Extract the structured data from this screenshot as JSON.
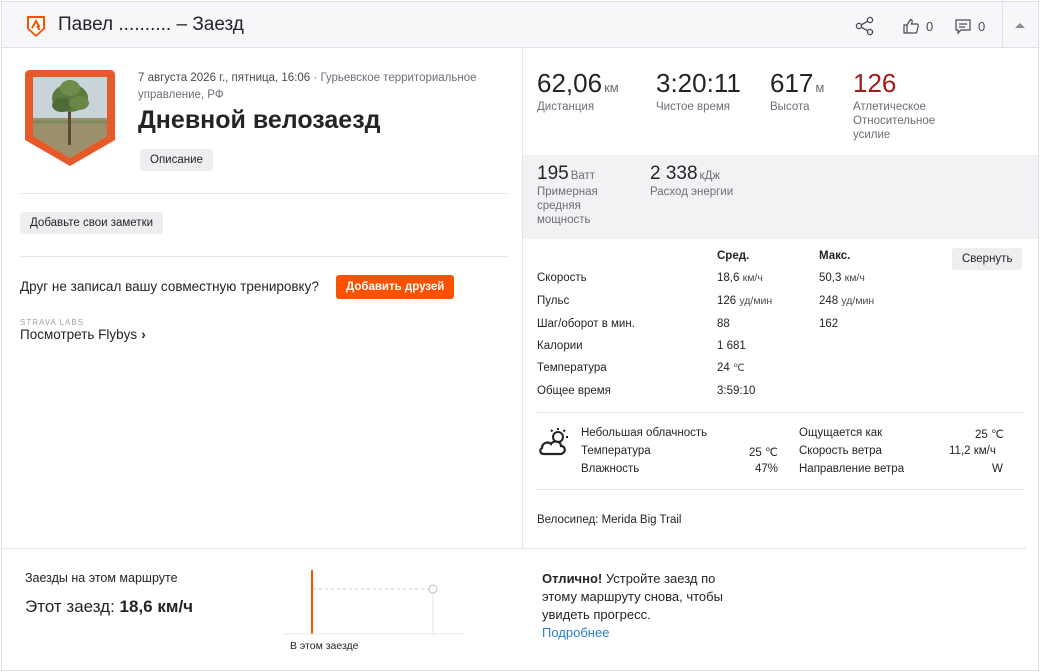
{
  "header": {
    "title": "Павел .......... – Заезд",
    "kudos_count": "0",
    "comments_count": "0"
  },
  "activity": {
    "datetime": "7 августа 2026 г., пятница, 16:06",
    "location": "Гурьевское территориальное управление, РФ",
    "title": "Дневной велозаезд",
    "description_button": "Описание"
  },
  "notes_button": "Добавьте свои заметки",
  "invite": {
    "text": "Друг не записал вашу совместную тренировку?",
    "button": "Добавить друзей"
  },
  "labs": {
    "tag": "STRAVA LABS",
    "link": "Посмотреть Flybys",
    "chevron": "›"
  },
  "primary_stats": [
    {
      "value": "62,06",
      "unit": "км",
      "label": "Дистанция"
    },
    {
      "value": "3:20:11",
      "unit": "",
      "label": "Чистое время"
    },
    {
      "value": "617",
      "unit": "м",
      "label": "Высота"
    },
    {
      "value": "126",
      "unit": "",
      "label": "Атлетическое Относительное усилие"
    }
  ],
  "secondary_stats": [
    {
      "value": "195",
      "unit": "Ватт",
      "label": "Примерная средняя мощность"
    },
    {
      "value": "2 338",
      "unit": "кДж",
      "label": "Расход энергии"
    }
  ],
  "more_stats": {
    "col_avg": "Сред.",
    "col_max": "Макс.",
    "collapse_button": "Свернуть",
    "rows": [
      {
        "label": "Скорость",
        "avg": "18,6",
        "avg_unit": "км/ч",
        "max": "50,3",
        "max_unit": "км/ч"
      },
      {
        "label": "Пульс",
        "avg": "126",
        "avg_unit": "уд/мин",
        "max": "248",
        "max_unit": "уд/мин"
      },
      {
        "label": "Шаг/оборот в мин.",
        "avg": "88",
        "avg_unit": "",
        "max": "162",
        "max_unit": ""
      },
      {
        "label": "Калории",
        "avg": "1 681",
        "avg_unit": "",
        "max": "",
        "max_unit": ""
      },
      {
        "label": "Температура",
        "avg": "24",
        "avg_unit": "℃",
        "max": "",
        "max_unit": ""
      },
      {
        "label": "Общее время",
        "avg": "3:59:10",
        "avg_unit": "",
        "max": "",
        "max_unit": ""
      }
    ]
  },
  "weather": {
    "icon": "partly-cloudy-icon",
    "condition": "Небольшая облачность",
    "temp_label": "Температура",
    "temp_value": "25 ℃",
    "humidity_label": "Влажность",
    "humidity_value": "47%",
    "feels_label": "Ощущается как",
    "feels_value": "25 ℃",
    "wind_speed_label": "Скорость ветра",
    "wind_speed_value": "11,2 км/ч",
    "wind_dir_label": "Направление ветра",
    "wind_dir_value": "W"
  },
  "bike": {
    "label": "Велосипед:",
    "name": "Merida Big Trail"
  },
  "segment": {
    "label": "Заезды на этом маршруте",
    "this_ride_label": "Этот заезд:",
    "this_ride_value": "18,6 км/ч",
    "chart_caption": "В этом заезде"
  },
  "progress_tip": {
    "bold": "Отлично!",
    "text": " Устройте заезд по этому маршруту снова, чтобы увидеть прогресс.",
    "link": "Подробнее"
  },
  "colors": {
    "brand_orange": "#fc5200",
    "effort_red": "#a31a1a",
    "link_blue": "#2a7ec8"
  }
}
